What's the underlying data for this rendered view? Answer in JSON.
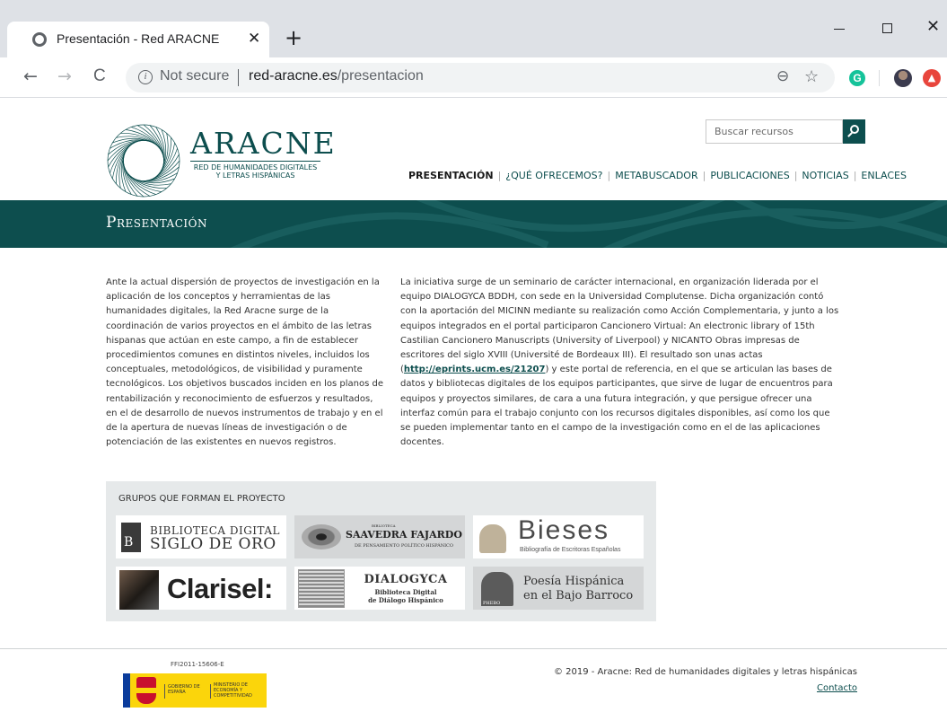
{
  "browser": {
    "tab_title": "Presentación - Red ARACNE",
    "tab_close": "✕",
    "new_tab": "+",
    "window_close": "✕",
    "nav_back": "←",
    "nav_forward": "→",
    "nav_reload": "C",
    "info_icon": "i",
    "security_label": "Not secure",
    "url_domain": "red-aracne.es",
    "url_path": "/presentacion",
    "zoom_icon": "⊖",
    "star_icon": "☆",
    "extension_label": "G"
  },
  "site": {
    "brand_name": "ARACNE",
    "brand_sub_line1": "RED DE HUMANIDADES DIGITALES",
    "brand_sub_line2": "Y LETRAS HISPÁNICAS",
    "search_placeholder": "Buscar recursos",
    "nav": [
      {
        "label": "PRESENTACIÓN"
      },
      {
        "label": "¿QUÉ OFRECEMOS?"
      },
      {
        "label": "METABUSCADOR"
      },
      {
        "label": "PUBLICACIONES"
      },
      {
        "label": "NOTICIAS"
      },
      {
        "label": "ENLACES"
      }
    ],
    "nav_separator": "|",
    "colors": {
      "brand": "#0d4e4e",
      "banner": "#0d4e4e",
      "groups_bg": "#e6e9ea"
    }
  },
  "banner": {
    "title": "Presentación"
  },
  "content": {
    "left_paragraph": "Ante la actual dispersión de proyectos de investigación en la aplicación de los conceptos y herramientas de las humanidades digitales, la Red Aracne surge de la coordinación de varios proyectos en el ámbito de las letras hispanas que actúan en este campo, a fin de establecer procedimientos comunes en distintos niveles, incluidos los conceptuales, metodológicos, de visibilidad y puramente tecnológicos. Los objetivos buscados inciden en los planos de rentabilización y reconocimiento de esfuerzos y resultados, en el de desarrollo de nuevos instrumentos de trabajo y en el de la apertura de nuevas líneas de investigación o de potenciación de las existentes en nuevos registros.",
    "right_before_link": "La iniciativa surge de un seminario de carácter internacional, en organización liderada por el equipo DIALOGYCA BDDH, con sede en la Universidad Complutense. Dicha organización contó con la aportación del MICINN mediante su realización como Acción Complementaria, y junto a los equipos integrados en el portal participaron Cancionero Virtual: An electronic library of 15th Castilian Cancionero Manuscripts (University of Liverpool) y NICANTO Obras impresas de escritores del siglo XVIII (Université de Bordeaux III). El resultado son unas actas (",
    "right_link": "http://eprints.ucm.es/21207",
    "right_after_link": ") y este portal de referencia, en el que se articulan las bases de datos y bibliotecas digitales de los equipos participantes, que sirve de lugar de encuentros para equipos y proyectos similares, de cara a una futura integración, y que persigue ofrecer una interfaz común para el trabajo conjunto con los recursos digitales disponibles, así como los que se pueden implementar tanto en el campo de la investigación como en el de las aplicaciones docentes."
  },
  "groups": {
    "title": "GRUPOS QUE FORMAN EL PROYECTO",
    "partners": [
      {
        "id": "bidiso",
        "mark": "B",
        "line1": "BIBLIOTECA DIGITAL",
        "line2": "SIGLO DE ORO"
      },
      {
        "id": "saavedra",
        "small": "BIBLIOTECA",
        "name": "SAAVEDRA FAJARDO",
        "tagline": "DE PENSAMIENTO POLÍTICO HISPÁNICO"
      },
      {
        "id": "bieses",
        "name": "Bieses",
        "tagline": "Bibliografía de Escritoras Españolas"
      },
      {
        "id": "clarisel",
        "name": "Clarisel:"
      },
      {
        "id": "dialogyca",
        "name": "DIALOGYCA",
        "line1": "Biblioteca Digital",
        "line2": "de Diálogo Hispánico"
      },
      {
        "id": "phebo",
        "mark": "PHEBO",
        "line1": "Poesía Hispánica",
        "line2": "en el Bajo Barroco"
      }
    ]
  },
  "footer": {
    "grant_code": "FFI2011-15606-E",
    "gob_label": "GOBIERNO DE ESPAÑA",
    "ministry_label": "MINISTERIO DE ECONOMÍA Y COMPETITIVIDAD",
    "copyright": "© 2019 - Aracne: Red de humanidades digitales y letras hispánicas",
    "contact": "Contacto"
  }
}
